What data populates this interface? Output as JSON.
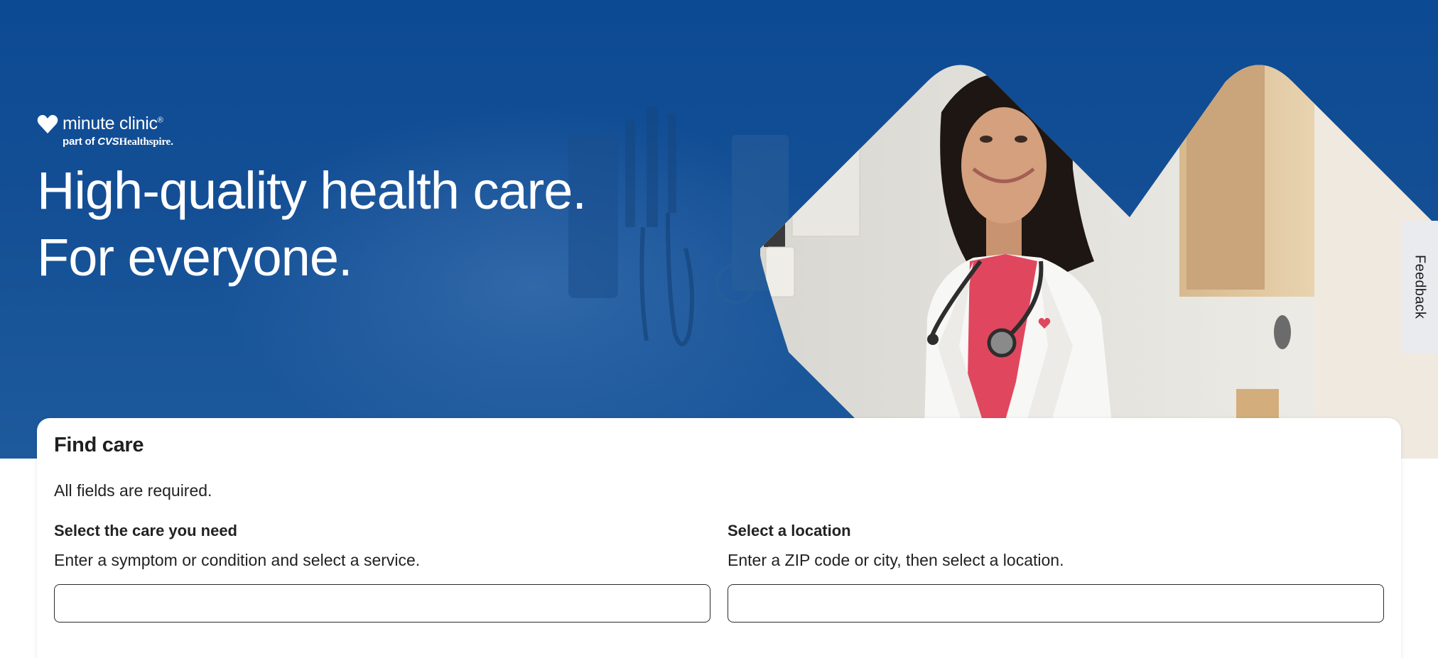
{
  "hero": {
    "logo": {
      "name": "minute clinic",
      "trademark": "®",
      "sub_prefix": "part of ",
      "sub_brand": "CVS",
      "sub_suffix": "Healthspire",
      "sub_mark": "."
    },
    "headline_line1": "High-quality health care.",
    "headline_line2": "For everyone."
  },
  "feedback": {
    "label": "Feedback"
  },
  "find_care": {
    "title": "Find care",
    "required_note": "All fields are required.",
    "care": {
      "label": "Select the care you need",
      "help": "Enter a symptom or condition and select a service.",
      "value": "",
      "placeholder": ""
    },
    "location": {
      "label": "Select a location",
      "help": "Enter a ZIP code or city, then select a location.",
      "value": "",
      "placeholder": ""
    }
  },
  "colors": {
    "hero_blue": "#0c4a93",
    "white": "#ffffff",
    "text_dark": "#222222",
    "feedback_bg": "#e9ebef",
    "scrub_pink": "#e0475f"
  },
  "icons": [
    "heart-logo-icon"
  ]
}
